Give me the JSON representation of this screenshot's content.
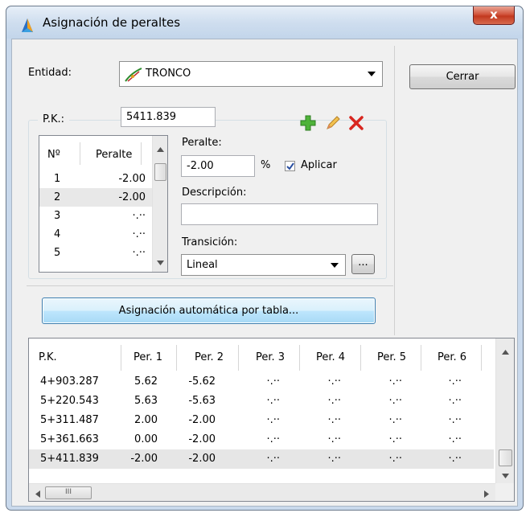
{
  "window": {
    "title": "Asignación de peraltes",
    "close_glyph": "x"
  },
  "entity": {
    "label": "Entidad:",
    "value": "TRONCO",
    "icon": "alignment-icon"
  },
  "close_button": "Cerrar",
  "pk": {
    "label": "P.K.:",
    "value": "5411.839"
  },
  "toolbar": {
    "add_icon": "plus-icon",
    "edit_icon": "pencil-icon",
    "delete_icon": "delete-x-icon"
  },
  "small_table": {
    "headers": [
      "Nº",
      "Peralte"
    ],
    "rows": [
      {
        "n": "1",
        "v": "-2.00"
      },
      {
        "n": "2",
        "v": "-2.00"
      },
      {
        "n": "3",
        "v": "·.··"
      },
      {
        "n": "4",
        "v": "·.··"
      },
      {
        "n": "5",
        "v": "·.··"
      }
    ]
  },
  "peralte": {
    "label": "Peralte:",
    "value": "-2.00",
    "unit": "%",
    "apply_label": "Aplicar",
    "apply_checked": true
  },
  "descripcion": {
    "label": "Descripción:",
    "value": ""
  },
  "transicion": {
    "label": "Transición:",
    "value": "Lineal",
    "more_button": "..."
  },
  "auto_button": "Asignación automática por tabla...",
  "big_table": {
    "headers": [
      "P.K.",
      "Per. 1",
      "Per. 2",
      "Per. 3",
      "Per. 4",
      "Per. 5",
      "Per. 6"
    ],
    "rows": [
      [
        "4+903.287",
        "5.62",
        "-5.62",
        "·.··",
        "·.··",
        "·.··",
        "·.··"
      ],
      [
        "5+220.543",
        "5.63",
        "-5.63",
        "·.··",
        "·.··",
        "·.··",
        "·.··"
      ],
      [
        "5+311.487",
        "2.00",
        "-2.00",
        "·.··",
        "·.··",
        "·.··",
        "·.··"
      ],
      [
        "5+361.663",
        "0.00",
        "-2.00",
        "·.··",
        "·.··",
        "·.··",
        "·.··"
      ],
      [
        "5+411.839",
        "-2.00",
        "-2.00",
        "·.··",
        "·.··",
        "·.··",
        "·.··"
      ]
    ],
    "hscroll_grip": "III"
  }
}
